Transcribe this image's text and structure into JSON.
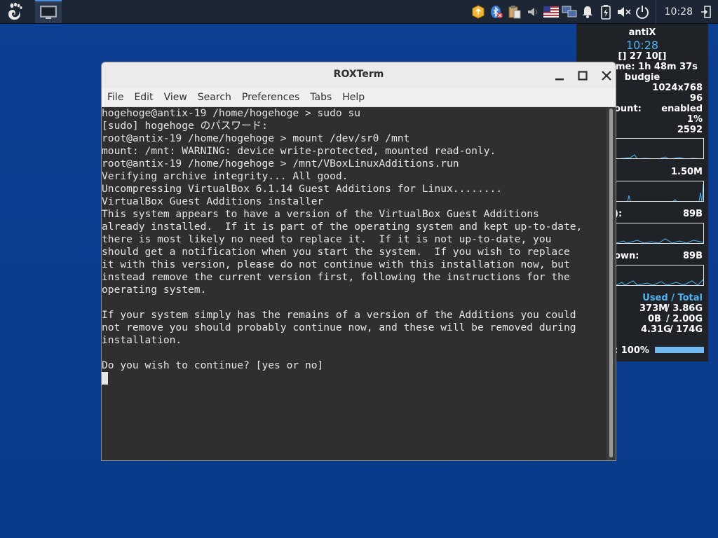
{
  "panel": {
    "clock": "10:28",
    "tray_icons": [
      "updater-icon",
      "bluetooth-icon",
      "clipboard-icon",
      "volume-muted-icon",
      "us-flag-icon",
      "network-icon",
      "notification-bell-icon",
      "battery-charging-icon",
      "speaker-muted-icon",
      "power-icon"
    ]
  },
  "window": {
    "title": "ROXTerm",
    "menu": [
      "File",
      "Edit",
      "View",
      "Search",
      "Preferences",
      "Tabs",
      "Help"
    ]
  },
  "terminal": {
    "lines": [
      "hogehoge@antix-19 /home/hogehoge > sudo su",
      "[sudo] hogehoge のパスワード:",
      "root@antix-19 /home/hogehoge > mount /dev/sr0 /mnt",
      "mount: /mnt: WARNING: device write-protected, mounted read-only.",
      "root@antix-19 /home/hogehoge > /mnt/VBoxLinuxAdditions.run",
      "Verifying archive integrity... All good.",
      "Uncompressing VirtualBox 6.1.14 Guest Additions for Linux........",
      "VirtualBox Guest Additions installer",
      "This system appears to have a version of the VirtualBox Guest Additions",
      "already installed.  If it is part of the operating system and kept up-to-date,",
      "there is most likely no need to replace it.  If it is not up-to-date, you",
      "should get a notification when you start the system.  If you wish to replace",
      "it with this version, please do not continue with this installation now, but",
      "instead remove the current version first, following the instructions for the",
      "operating system.",
      "",
      "If your system simply has the remains of a version of the Additions you could",
      "not remove you should probably continue now, and these will be removed during",
      "installation.",
      "",
      "Do you wish to continue? [yes or no]"
    ]
  },
  "conky": {
    "hostname": "antiX",
    "time": "10:28",
    "date": "[] 27 10[]",
    "uptime": "me: 1h 48m 37s",
    "user": "budgie",
    "resolution": "1024x768",
    "dpi": "96",
    "mount_label": "ount:",
    "mount_value": "enabled",
    "cpu": "1%",
    "freq": "2592",
    "disk_io": "1.50M",
    "up_label": "):",
    "up_value": "89B",
    "down_label": "own:",
    "down_value": "89B",
    "used_total": "Used / Total",
    "mem_used": "373M",
    "mem_total": "/ 3.86G",
    "swap_used": "0B",
    "swap_total": "/ 2.00G",
    "disk_used": "4.31G",
    "disk_total": "/ 174G",
    "battery_label": ": 100%",
    "battery_level": 1.0
  },
  "colors": {
    "desktop": "#0b3b8c",
    "panel": "#1d2634",
    "conky_accent": "#4fb3f0",
    "battery_bar": "#6fb8f0"
  }
}
